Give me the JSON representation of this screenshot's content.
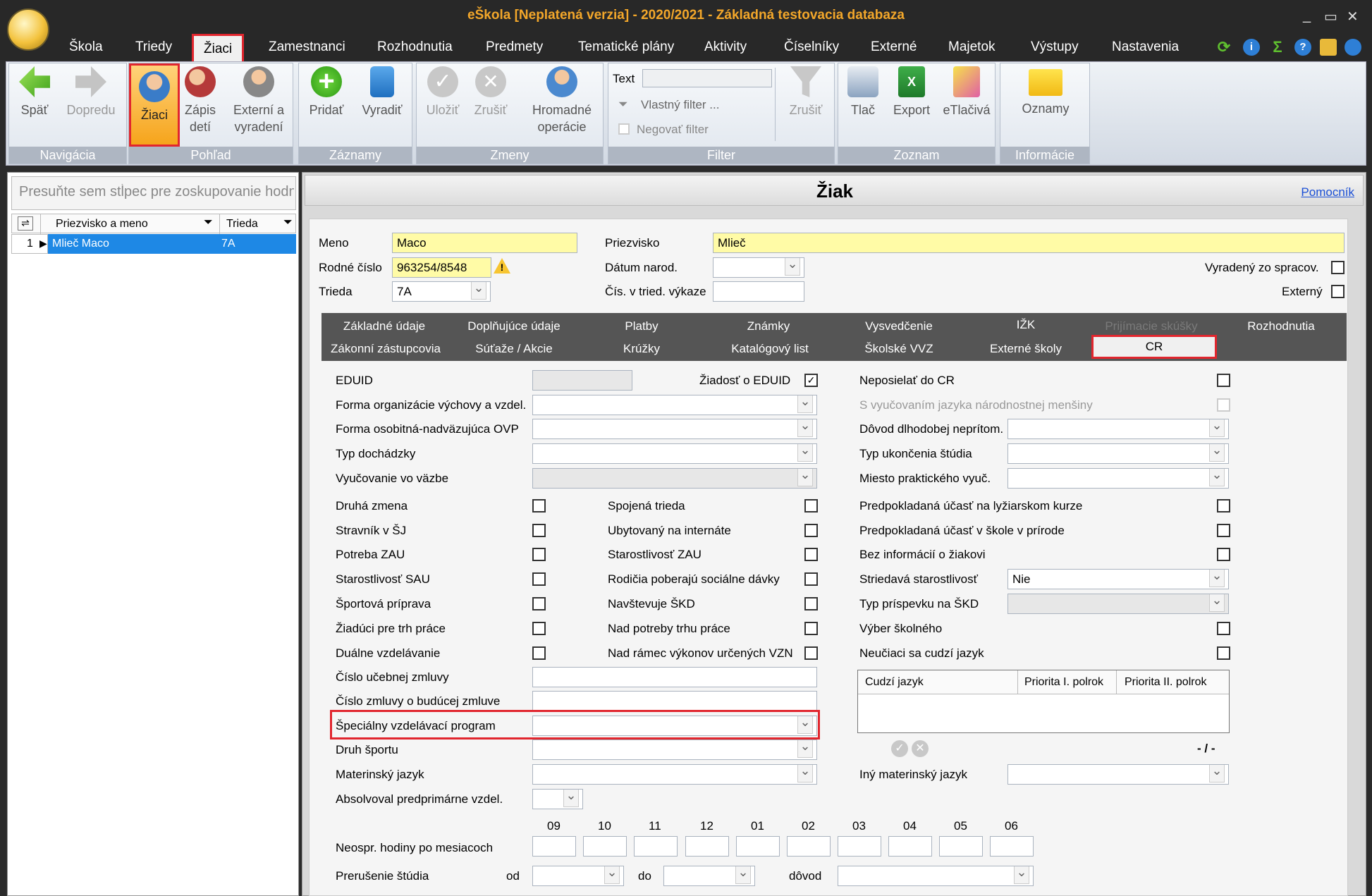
{
  "app": {
    "title": "eŠkola [Neplatená verzia] - 2020/2021 - Základná testovacia databaza"
  },
  "menu": [
    "Škola",
    "Triedy",
    "Žiaci",
    "Zamestnanci",
    "Rozhodnutia",
    "Predmety",
    "Tematické plány",
    "Aktivity",
    "Číselníky",
    "Externé",
    "Majetok",
    "Výstupy",
    "Nastavenia"
  ],
  "ribbon": {
    "navigacia": {
      "label": "Navigácia",
      "back": "Späť",
      "forward": "Dopredu"
    },
    "pohlad": {
      "label": "Pohľad",
      "ziaci": "Žiaci",
      "zapis1": "Zápis",
      "zapis2": "detí",
      "ext1": "Externí a",
      "ext2": "vyradení"
    },
    "zaznamy": {
      "label": "Záznamy",
      "add": "Pridať",
      "remove": "Vyradiť"
    },
    "zmeny": {
      "label": "Zmeny",
      "save": "Uložiť",
      "cancel": "Zrušiť",
      "bulk1": "Hromadné",
      "bulk2": "operácie"
    },
    "filter": {
      "label": "Filter",
      "text": "Text",
      "own": "Vlastný filter ...",
      "negate": "Negovať filter",
      "clear": "Zrušiť"
    },
    "zoznam": {
      "label": "Zoznam",
      "print": "Tlač",
      "export": "Export",
      "etlac": "eTlačivá"
    },
    "informacie": {
      "label": "Informácie",
      "notices": "Oznamy"
    }
  },
  "grid": {
    "group_placeholder": "Presuňte sem stĺpec pre zoskupovanie hodnôt",
    "col_name": "Priezvisko a meno",
    "col_class": "Trieda",
    "rows": [
      {
        "num": "1",
        "name": "Mlieč Maco",
        "class": "7A"
      }
    ]
  },
  "panel": {
    "title": "Žiak",
    "help": "Pomocník"
  },
  "student": {
    "meno_l": "Meno",
    "meno": "Maco",
    "priezvisko_l": "Priezvisko",
    "priezvisko": "Mlieč",
    "rc_l": "Rodné číslo",
    "rc": "963254/8548",
    "datum_l": "Dátum narod.",
    "vyradeny_l": "Vyradený zo spracov.",
    "trieda_l": "Trieda",
    "trieda": "7A",
    "cis_l": "Čís. v tried. výkaze",
    "externy_l": "Externý"
  },
  "tabs": {
    "r1": [
      "Základné údaje",
      "Doplňujúce údaje",
      "Platby",
      "Známky",
      "Vysvedčenie",
      "IŽK",
      "Prijímacie skúšky",
      "Rozhodnutia"
    ],
    "r2": [
      "Zákonní zástupcovia",
      "Súťaže / Akcie",
      "Krúžky",
      "Katalógový list",
      "Školské VVZ",
      "Externé školy",
      "CR"
    ]
  },
  "cr": {
    "eduid": "EDUID",
    "ziadost": "Žiadosť o EDUID",
    "neposielat": "Neposielať do CR",
    "forma_org": "Forma organizácie výchovy a vzdel.",
    "s_vyuc": "S vyučovaním jazyka národnostnej menšiny",
    "forma_osob": "Forma osobitná-nadväzujúca OVP",
    "dovod": "Dôvod dlhodobej neprítom.",
    "typ_doch": "Typ dochádzky",
    "typ_uk": "Typ ukončenia štúdia",
    "vyuc_vazbe": "Vyučovanie vo väzbe",
    "miesto": "Miesto praktického vyuč.",
    "c1": [
      "Druhá zmena",
      "Stravník v ŠJ",
      "Potreba ZAU",
      "Starostlivosť SAU",
      "Športová príprava",
      "Žiadúci pre trh práce",
      "Duálne vzdelávanie"
    ],
    "c2": [
      "Spojená trieda",
      "Ubytovaný na internáte",
      "Starostlivosť ZAU",
      "Rodičia poberajú sociálne dávky",
      "Navštevuje ŠKD",
      "Nad potreby trhu práce",
      "Nad rámec výkonov určených VZN"
    ],
    "c3": [
      "Predpokladaná účasť na lyžiarskom kurze",
      "Predpokladaná účasť v škole v prírode",
      "Bez informácií o žiakovi",
      "Striedavá starostlivosť",
      "Typ príspevku na ŠKD",
      "Výber školného",
      "Neučiaci sa cudzí jazyk"
    ],
    "striedava_val": "Nie",
    "cislo_ucebnej": "Číslo učebnej zmluvy",
    "cislo_buducej": "Číslo zmluvy o budúcej zmluve",
    "svp": "Špeciálny vzdelávací program",
    "druh_sportu": "Druh športu",
    "materinsky": "Materinský jazyk",
    "iny_mat": "Iný materinský jazyk",
    "absolvoval": "Absolvoval predprimárne vzdel.",
    "lang_cols": [
      "Cudzí jazyk",
      "Priorita I. polrok",
      "Priorita II. polrok"
    ],
    "lang_counter": "- / -",
    "months": [
      "09",
      "10",
      "11",
      "12",
      "01",
      "02",
      "03",
      "04",
      "05",
      "06"
    ],
    "neospr": "Neospr. hodiny po mesiacoch",
    "prerusenie": "Prerušenie štúdia",
    "od": "od",
    "do": "do",
    "dovod2": "dôvod"
  }
}
